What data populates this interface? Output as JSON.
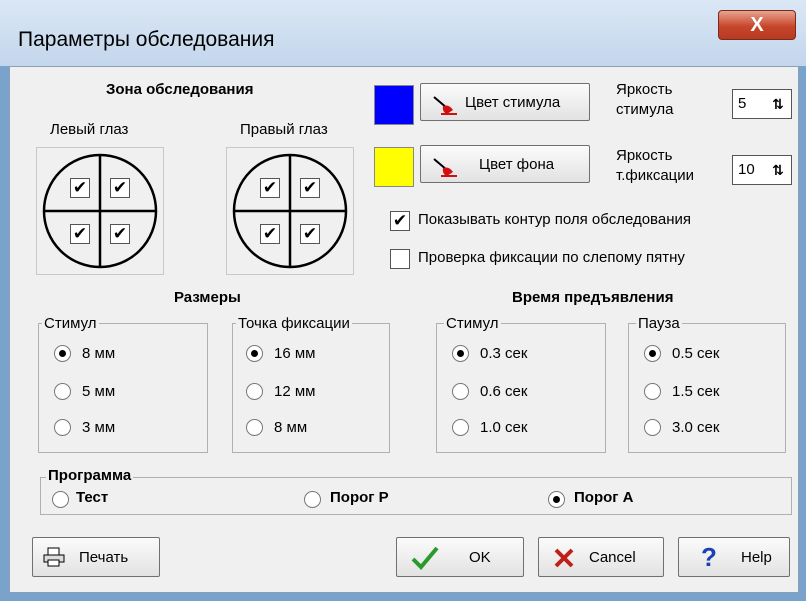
{
  "window": {
    "title": "Параметры обследования",
    "close_glyph": "X"
  },
  "zone": {
    "heading": "Зона обследования",
    "left_eye": "Левый глаз",
    "right_eye": "Правый глаз",
    "quadrants_checked": true
  },
  "colors": {
    "stimulus_button": "Цвет стимула",
    "background_button": "Цвет фона",
    "stimulus_swatch": "#0000ff",
    "background_swatch": "#ffff00"
  },
  "brightness": {
    "stimulus_label_1": "Яркость",
    "stimulus_label_2": "стимула",
    "stimulus_value": "5",
    "fixation_label_1": "Яркость",
    "fixation_label_2": "т.фиксации",
    "fixation_value": "10"
  },
  "options": [
    {
      "label": "Показывать контур поля обследования",
      "checked": true
    },
    {
      "label": "Проверка фиксации по слепому пятну",
      "checked": false
    }
  ],
  "sizes": {
    "heading": "Размеры",
    "stimulus_group": "Стимул",
    "stimulus_options": [
      {
        "label": "8 мм",
        "selected": true
      },
      {
        "label": "5 мм",
        "selected": false
      },
      {
        "label": "3 мм",
        "selected": false
      }
    ],
    "fixation_group": "Точка фиксации",
    "fixation_options": [
      {
        "label": "16 мм",
        "selected": true
      },
      {
        "label": "12 мм",
        "selected": false
      },
      {
        "label": "8 мм",
        "selected": false
      }
    ]
  },
  "timing": {
    "heading": "Время предъявления",
    "stimulus_group": "Стимул",
    "stimulus_options": [
      {
        "label": "0.3 сек",
        "selected": true
      },
      {
        "label": "0.6 сек",
        "selected": false
      },
      {
        "label": "1.0 сек",
        "selected": false
      }
    ],
    "pause_group": "Пауза",
    "pause_options": [
      {
        "label": "0.5 сек",
        "selected": true
      },
      {
        "label": "1.5 сек",
        "selected": false
      },
      {
        "label": "3.0 сек",
        "selected": false
      }
    ]
  },
  "program": {
    "group": "Программа",
    "options": [
      {
        "label": "Тест",
        "selected": false
      },
      {
        "label": "Порог Р",
        "selected": false
      },
      {
        "label": "Порог А",
        "selected": true
      }
    ]
  },
  "buttons": {
    "print": "Печать",
    "ok": "OK",
    "cancel": "Cancel",
    "help": "Help"
  },
  "icons": [
    "close-icon",
    "brush-icon",
    "printer-icon",
    "checkmark-icon",
    "cross-icon",
    "question-icon",
    "spin-arrows-icon"
  ]
}
